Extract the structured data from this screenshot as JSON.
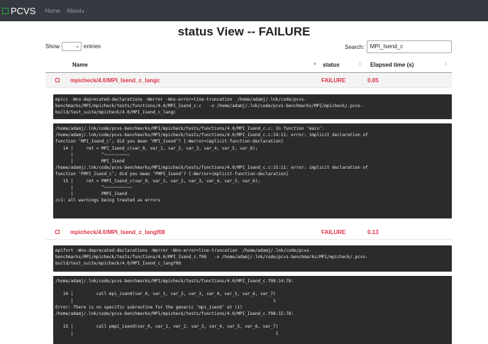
{
  "navbar": {
    "brand": "PCVS",
    "home": "Home",
    "about": "About"
  },
  "page": {
    "title": "status View -- FAILURE"
  },
  "controls": {
    "show_label": "Show",
    "entries_label": "entries",
    "search_label": "Search:",
    "search_value": "MPI_Isend_c"
  },
  "table": {
    "headers": {
      "name": "Name",
      "status": "status",
      "elapsed": "Elapsed time (s)"
    },
    "rows": [
      {
        "name": "mpicheck/4.0/MPI_Isend_c_langc",
        "status": "FAILURE",
        "elapsed": "0.05",
        "command": "mpicc -Wno-deprecated-declarations -Werror -Wno-error=line-truncation  /home/adamj/.lnk/code/pcvs-\nbenchmarks/MPI/mpicheck/tests/functions/4.0/MPI_Isend_c.c   -o /home/adamj/.lnk/code/pcvs-benchmarks/MPI/mpicheck/.pcvs-\nbuild/test_suite/mpicheck/4.0/MPI_Isend_c_langc",
        "output": "/home/adamj/.lnk/code/pcvs-benchmarks/MPI/mpicheck/tests/functions/4.0/MPI_Isend_c.c: In function ‘main’:\n/home/adamj/.lnk/code/pcvs-benchmarks/MPI/mpicheck/tests/functions/4.0/MPI_Isend_c.c:14:11: error: implicit declaration of\nfunction ‘MPI_Isend_c’; did you mean ‘MPI_Isend’? [-Werror=implicit-function-declaration]\n   14 |     ret = MPI_Isend_c(var_0, var_1, var_2, var_3, var_4, var_5, var_6);\n      |           ^~~~~~~~~~~\n      |           MPI_Isend\n/home/adamj/.lnk/code/pcvs-benchmarks/MPI/mpicheck/tests/functions/4.0/MPI_Isend_c.c:15:11: error: implicit declaration of\nfunction ‘PMPI_Isend_c’; did you mean ‘PMPI_Isend’? [-Werror=implicit-function-declaration]\n   15 |     ret = PMPI_Isend_c(var_0, var_1, var_2, var_3, var_4, var_5, var_6);\n      |           ^~~~~~~~~~~~\n      |           PMPI_Isend\ncc1: all warnings being treated as errors"
      },
      {
        "name": "mpicheck/4.0/MPI_Isend_c_langf08",
        "status": "FAILURE",
        "elapsed": "0.13",
        "command": "mpifort -Wno-deprecated-declarations -Werror -Wno-error=line-truncation  /home/adamj/.lnk/code/pcvs-\nbenchmarks/MPI/mpicheck/tests/functions/4.0/MPI_Isend_c.f08   -o /home/adamj/.lnk/code/pcvs-benchmarks/MPI/mpicheck/.pcvs-\nbuild/test_suite/mpicheck/4.0/MPI_Isend_c_langf08",
        "output": "/home/adamj/.lnk/code/pcvs-benchmarks/MPI/mpicheck/tests/functions/4.0/MPI_Isend_c.f08:14:78:\n\n   14 |         call mpi_isend(var_0, var_1, var_2, var_3, var_4, var_5, var_6, var_7)\n      |                                                                              1\nError: There is no specific subroutine for the generic ‘mpi_isend’ at (1)\n/home/adamj/.lnk/code/pcvs-benchmarks/MPI/mpicheck/tests/functions/4.0/MPI_Isend_c.f08:15:78:\n\n   15 |         call pmpi_isend(var_0, var_1, var_2, var_3, var_4, var_5, var_6, var_7)\n      |                                                                               1"
      }
    ]
  }
}
